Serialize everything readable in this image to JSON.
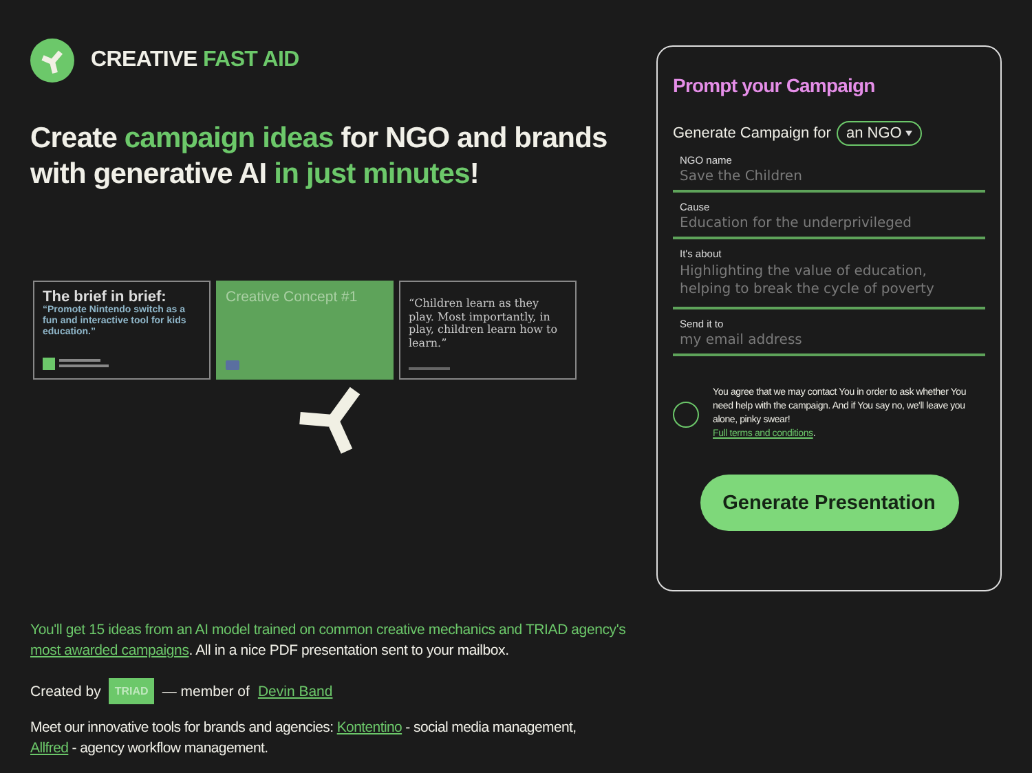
{
  "brand": {
    "parts": [
      {
        "text": "CREATIVE",
        "accent": false
      },
      {
        "text": "FAST AID",
        "accent": true
      }
    ]
  },
  "headline": [
    {
      "text": "Create ",
      "accent": false
    },
    {
      "text": "campaign ideas",
      "accent": true
    },
    {
      "text": " for NGO and brands with generative AI ",
      "accent": false
    },
    {
      "text": "in just minutes",
      "accent": true
    },
    {
      "text": "!",
      "accent": false
    }
  ],
  "slides": [
    {
      "kind": "brief",
      "title": "The brief in brief:",
      "body": "“Promote Nintendo switch as a fun and interactive tool for kids education.”"
    },
    {
      "kind": "concept",
      "title": "Creative Concept #1"
    },
    {
      "kind": "quote",
      "body": "“Children learn as they play. Most importantly, in play, children learn how to learn.”"
    }
  ],
  "info": [
    {
      "kind": "accent",
      "text": "You'll get 15 ideas from an AI model trained on common creative mechanics and TRIAD agency's "
    },
    {
      "kind": "link",
      "text": "most awarded campaigns"
    },
    {
      "kind": "plain",
      "text": ". All in a nice PDF presentation sent to your mailbox."
    }
  ],
  "credits": {
    "created_by": "Created by",
    "badge": "TRIAD",
    "member_of": "—  member of",
    "link": "Devin Band"
  },
  "tools": [
    {
      "kind": "plain",
      "text": "Meet our innovative tools for brands and agencies: "
    },
    {
      "kind": "link",
      "text": "Kontentino"
    },
    {
      "kind": "plain",
      "text": " - social media management, "
    },
    {
      "kind": "link",
      "text": "Allfred"
    },
    {
      "kind": "plain",
      "text": " - agency workflow management."
    }
  ],
  "form": {
    "title": "Prompt your Campaign",
    "generate_for": "Generate Campaign for",
    "target": "an NGO",
    "fields": [
      {
        "label": "NGO name",
        "placeholder": "Save the Children"
      },
      {
        "label": "Cause",
        "placeholder": "Education for the underprivileged"
      },
      {
        "label": "It's about",
        "placeholder": "Highlighting the value of education, helping to break the cycle of poverty"
      },
      {
        "label": "Send it to",
        "placeholder": "my email address"
      }
    ],
    "consent": {
      "checked": false,
      "text": "You agree that we may contact You in order to ask whether You need help with the campaign. And if You say no, we'll leave you alone, pinky swear!",
      "link": "Full terms and conditions",
      "after": "."
    },
    "button": "Generate Presentation"
  }
}
